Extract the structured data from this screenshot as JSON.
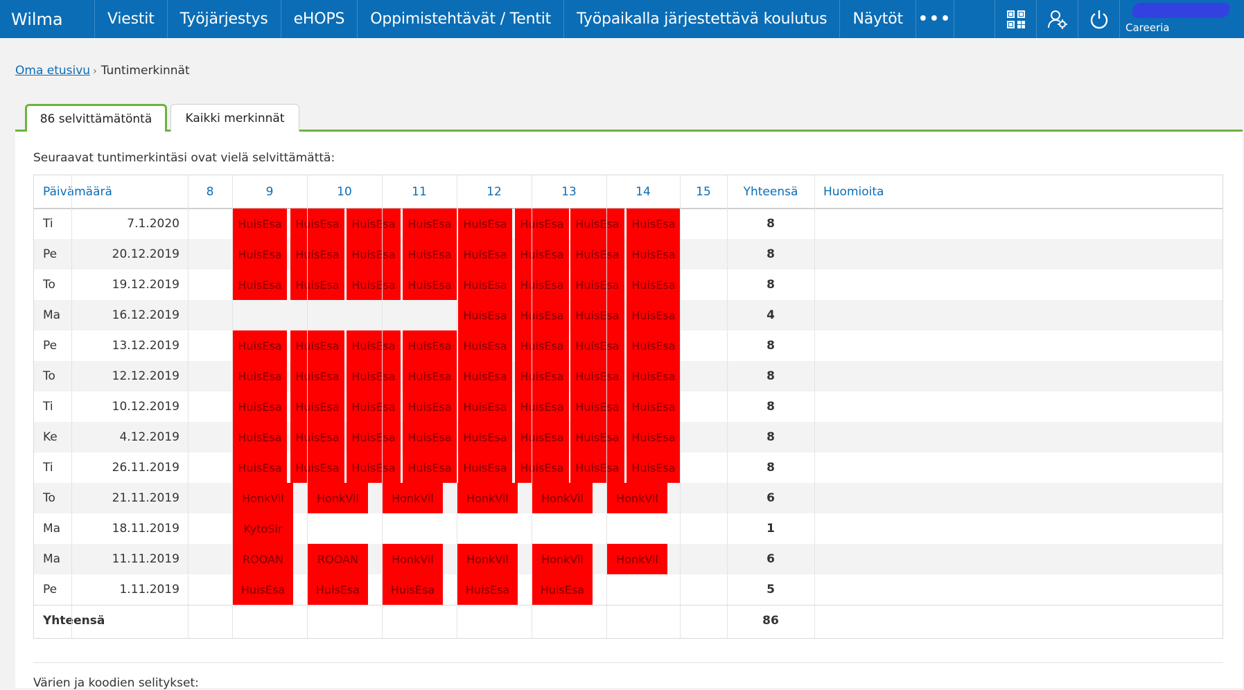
{
  "nav": {
    "brand": "Wilma",
    "items": [
      "Viestit",
      "Työjärjestys",
      "eHOPS",
      "Oppimistehtävät / Tentit",
      "Työpaikalla järjestettävä koulutus",
      "Näytöt"
    ],
    "more": "•••",
    "org": "Careeria",
    "icons": [
      "qr-code-icon",
      "user-settings-icon",
      "power-icon"
    ]
  },
  "breadcrumb": {
    "home": "Oma etusivu",
    "current": "Tuntimerkinnät"
  },
  "tabs": [
    {
      "label": "86 selvittämätöntä",
      "active": true
    },
    {
      "label": "Kaikki merkinnät",
      "active": false
    }
  ],
  "intro": "Seuraavat tuntimerkintäsi ovat vielä selvittämättä:",
  "table": {
    "headers": {
      "date": "Päivämäärä",
      "hours": [
        "8",
        "9",
        "10",
        "11",
        "12",
        "13",
        "14",
        "15"
      ],
      "total": "Yhteensä",
      "notes": "Huomioita"
    },
    "rows": [
      {
        "day": "Ti",
        "date": "7.1.2020",
        "total": "8",
        "marks": [
          [
            "q",
            2,
            "HuisEsa"
          ],
          [
            "q",
            3,
            "HuisEsa"
          ],
          [
            "q",
            4,
            "HuisEsa"
          ],
          [
            "q",
            5,
            "HuisEsa"
          ],
          [
            "q",
            6,
            "HuisEsa"
          ],
          [
            "q",
            7,
            "HuisEsa"
          ],
          [
            "q",
            8,
            "HuisEsa"
          ],
          [
            "q",
            9,
            "HuisEsa"
          ]
        ]
      },
      {
        "day": "Pe",
        "date": "20.12.2019",
        "total": "8",
        "marks": [
          [
            "q",
            2,
            "HuisEsa"
          ],
          [
            "q",
            3,
            "HuisEsa"
          ],
          [
            "q",
            4,
            "HuisEsa"
          ],
          [
            "q",
            5,
            "HuisEsa"
          ],
          [
            "q",
            6,
            "HuisEsa"
          ],
          [
            "q",
            7,
            "HuisEsa"
          ],
          [
            "q",
            8,
            "HuisEsa"
          ],
          [
            "q",
            9,
            "HuisEsa"
          ]
        ]
      },
      {
        "day": "To",
        "date": "19.12.2019",
        "total": "8",
        "marks": [
          [
            "q",
            2,
            "HuisEsa"
          ],
          [
            "q",
            3,
            "HuisEsa"
          ],
          [
            "q",
            4,
            "HuisEsa"
          ],
          [
            "q",
            5,
            "HuisEsa"
          ],
          [
            "q",
            6,
            "HuisEsa"
          ],
          [
            "q",
            7,
            "HuisEsa"
          ],
          [
            "q",
            8,
            "HuisEsa"
          ],
          [
            "q",
            9,
            "HuisEsa"
          ]
        ]
      },
      {
        "day": "Ma",
        "date": "16.12.2019",
        "total": "4",
        "marks": [
          [
            "q",
            6,
            "HuisEsa"
          ],
          [
            "q",
            7,
            "HuisEsa"
          ],
          [
            "q",
            8,
            "HuisEsa"
          ],
          [
            "q",
            9,
            "HuisEsa"
          ]
        ]
      },
      {
        "day": "Pe",
        "date": "13.12.2019",
        "total": "8",
        "marks": [
          [
            "q",
            2,
            "HuisEsa"
          ],
          [
            "q",
            3,
            "HuisEsa"
          ],
          [
            "q",
            4,
            "HuisEsa"
          ],
          [
            "q",
            5,
            "HuisEsa"
          ],
          [
            "q",
            6,
            "HuisEsa"
          ],
          [
            "q",
            7,
            "HuisEsa"
          ],
          [
            "q",
            8,
            "HuisEsa"
          ],
          [
            "q",
            9,
            "HuisEsa"
          ]
        ]
      },
      {
        "day": "To",
        "date": "12.12.2019",
        "total": "8",
        "marks": [
          [
            "q",
            2,
            "HuisEsa"
          ],
          [
            "q",
            3,
            "HuisEsa"
          ],
          [
            "q",
            4,
            "HuisEsa"
          ],
          [
            "q",
            5,
            "HuisEsa"
          ],
          [
            "q",
            6,
            "HuisEsa"
          ],
          [
            "q",
            7,
            "HuisEsa"
          ],
          [
            "q",
            8,
            "HuisEsa"
          ],
          [
            "q",
            9,
            "HuisEsa"
          ]
        ]
      },
      {
        "day": "Ti",
        "date": "10.12.2019",
        "total": "8",
        "marks": [
          [
            "q",
            2,
            "HuisEsa"
          ],
          [
            "q",
            3,
            "HuisEsa"
          ],
          [
            "q",
            4,
            "HuisEsa"
          ],
          [
            "q",
            5,
            "HuisEsa"
          ],
          [
            "q",
            6,
            "HuisEsa"
          ],
          [
            "q",
            7,
            "HuisEsa"
          ],
          [
            "q",
            8,
            "HuisEsa"
          ],
          [
            "q",
            9,
            "HuisEsa"
          ]
        ]
      },
      {
        "day": "Ke",
        "date": "4.12.2019",
        "total": "8",
        "marks": [
          [
            "q",
            2,
            "HuisEsa"
          ],
          [
            "q",
            3,
            "HuisEsa"
          ],
          [
            "q",
            4,
            "HuisEsa"
          ],
          [
            "q",
            5,
            "HuisEsa"
          ],
          [
            "q",
            6,
            "HuisEsa"
          ],
          [
            "q",
            7,
            "HuisEsa"
          ],
          [
            "q",
            8,
            "HuisEsa"
          ],
          [
            "q",
            9,
            "HuisEsa"
          ]
        ]
      },
      {
        "day": "Ti",
        "date": "26.11.2019",
        "total": "8",
        "marks": [
          [
            "q",
            2,
            "HuisEsa"
          ],
          [
            "q",
            3,
            "HuisEsa"
          ],
          [
            "q",
            4,
            "HuisEsa"
          ],
          [
            "q",
            5,
            "HuisEsa"
          ],
          [
            "q",
            6,
            "HuisEsa"
          ],
          [
            "q",
            7,
            "HuisEsa"
          ],
          [
            "q",
            8,
            "HuisEsa"
          ],
          [
            "q",
            9,
            "HuisEsa"
          ]
        ]
      },
      {
        "day": "To",
        "date": "21.11.2019",
        "total": "6",
        "marks": [
          [
            "h",
            2,
            "HonkVil"
          ],
          [
            "h",
            3,
            "HonkVil"
          ],
          [
            "h",
            4,
            "HonkVil"
          ],
          [
            "h",
            5,
            "HonkVil"
          ],
          [
            "h",
            6,
            "HonkVil"
          ],
          [
            "h",
            7,
            "HonkVil"
          ]
        ]
      },
      {
        "day": "Ma",
        "date": "18.11.2019",
        "total": "1",
        "marks": [
          [
            "h",
            2,
            "KytoSir"
          ]
        ]
      },
      {
        "day": "Ma",
        "date": "11.11.2019",
        "total": "6",
        "marks": [
          [
            "h",
            2,
            "ROOAN"
          ],
          [
            "h",
            3,
            "ROOAN"
          ],
          [
            "h",
            4,
            "HonkVil"
          ],
          [
            "h",
            5,
            "HonkVil"
          ],
          [
            "h",
            6,
            "HonkVil"
          ],
          [
            "h",
            7,
            "HonkVil"
          ]
        ]
      },
      {
        "day": "Pe",
        "date": "1.11.2019",
        "total": "5",
        "marks": [
          [
            "h",
            2,
            "HuisEsa"
          ],
          [
            "h",
            3,
            "HuisEsa"
          ],
          [
            "h",
            4,
            "HuisEsa"
          ],
          [
            "h",
            5,
            "HuisEsa"
          ],
          [
            "h",
            6,
            "HuisEsa"
          ]
        ]
      }
    ],
    "sum_label": "Yhteensä",
    "sum_total": "86"
  },
  "legend_title": "Värien ja koodien selitykset:",
  "colors": {
    "nav": "#0b6db5",
    "mark": "#ff0000",
    "tab_accent": "#6cb33f"
  }
}
